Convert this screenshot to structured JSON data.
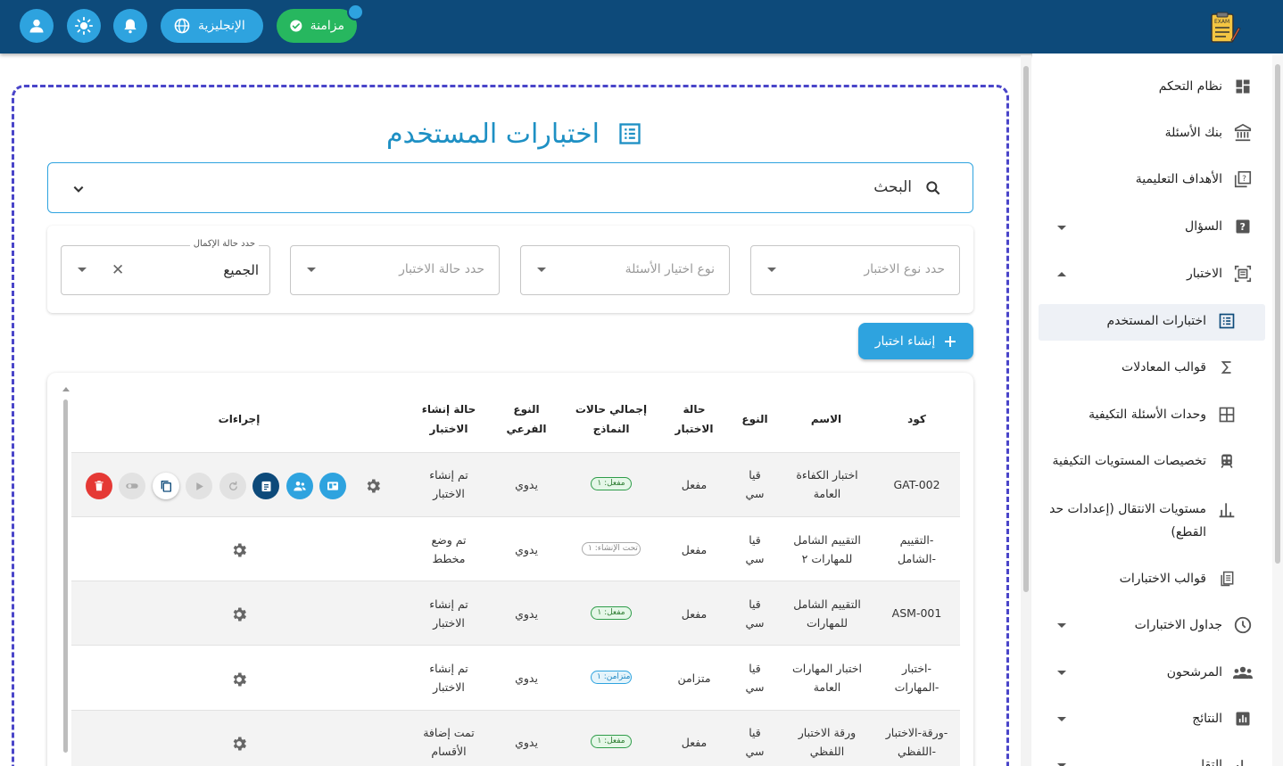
{
  "topbar": {
    "sync_label": "مزامنة",
    "language_label": "الإنجليزية",
    "logo_text": "EXAM"
  },
  "sidebar": {
    "items": [
      {
        "label": "نظام التحكم",
        "icon": "dashboard-icon"
      },
      {
        "label": "بنك الأسئلة",
        "icon": "bank-icon"
      },
      {
        "label": "الأهداف التعليمية",
        "icon": "objectives-icon"
      },
      {
        "label": "السؤال",
        "icon": "question-icon",
        "expandable": true
      },
      {
        "label": "الاختبار",
        "icon": "exam-icon",
        "expandable": true,
        "expanded": true
      },
      {
        "label": "اختبارات المستخدم",
        "icon": "list-icon",
        "active": true
      },
      {
        "label": "قوالب المعادلات",
        "icon": "sigma-icon"
      },
      {
        "label": "وحدات الأسئلة التكيفية",
        "icon": "grid-icon"
      },
      {
        "label": "تخصيصات المستويات التكيفية",
        "icon": "train-icon"
      },
      {
        "label": "مستويات الانتقال (إعدادات حد القطع)",
        "icon": "bar-chart-icon"
      },
      {
        "label": "قوالب الاختبارات",
        "icon": "template-icon"
      },
      {
        "label": "جداول الاختبارات",
        "icon": "clock-icon",
        "expandable": true
      },
      {
        "label": "المرشحون",
        "icon": "people-icon",
        "expandable": true
      },
      {
        "label": "النتائج",
        "icon": "results-icon",
        "expandable": true
      },
      {
        "label": "التقا",
        "icon": "reports-icon",
        "expandable": true
      }
    ]
  },
  "main": {
    "title": "اختبارات المستخدم",
    "search_label": "البحث",
    "filters": {
      "exam_type_placeholder": "حدد نوع الاختبار",
      "question_type_placeholder": "نوع اختيار الأسئلة",
      "exam_status_placeholder": "حدد حالة الاختبار",
      "completion_label": "حدد حالة الإكمال",
      "completion_value": "الجميع"
    },
    "create_button": "إنشاء اختبار"
  },
  "table": {
    "headers": {
      "code": "كود",
      "name": "الاسم",
      "type": "النوع",
      "status_1": "حالة",
      "status_2": "الاختبار",
      "forms_1": "إجمالي حالات",
      "forms_2": "النماذج",
      "subtype_1": "النوع",
      "subtype_2": "الفرعي",
      "creation_1": "حالة إنشاء",
      "creation_2": "الاختبار",
      "actions": "إجراءات"
    },
    "rows": [
      {
        "code_1": "GAT-002",
        "code_2": "",
        "name_1": "اختبار الكفاءة",
        "name_2": "العامة",
        "type_1": "قيا",
        "type_2": "سي",
        "status": "مفعل",
        "forms": "مفعل: ١",
        "forms_style": "green",
        "subtype": "يدوي",
        "creation_1": "تم إنشاء",
        "creation_2": "الاختبار"
      },
      {
        "code_1": "التقييم-",
        "code_2": "الشامل-",
        "name_1": "التقييم الشامل",
        "name_2": "للمهارات ٢",
        "type_1": "قيا",
        "type_2": "سي",
        "status": "مفعل",
        "forms": "تحت الإنشاء: ١",
        "forms_style": "gray",
        "subtype": "يدوي",
        "creation_1": "تم وضع",
        "creation_2": "مخطط"
      },
      {
        "code_1": "ASM-001",
        "code_2": "",
        "name_1": "التقييم الشامل",
        "name_2": "للمهارات",
        "type_1": "قيا",
        "type_2": "سي",
        "status": "مفعل",
        "forms": "مفعل: ١",
        "forms_style": "green",
        "subtype": "يدوي",
        "creation_1": "تم إنشاء",
        "creation_2": "الاختبار"
      },
      {
        "code_1": "اختبار-",
        "code_2": "المهارات-",
        "name_1": "اختبار المهارات",
        "name_2": "العامة",
        "type_1": "قيا",
        "type_2": "سي",
        "status": "متزامن",
        "forms": "متزامن: ١",
        "forms_style": "blue",
        "subtype": "يدوي",
        "creation_1": "تم إنشاء",
        "creation_2": "الاختبار"
      },
      {
        "code_1": "ورقة-الاختبار-",
        "code_2": "اللفظي-",
        "name_1": "ورقة الاختبار",
        "name_2": "اللفظي",
        "type_1": "قيا",
        "type_2": "سي",
        "status": "مفعل",
        "forms": "مفعل: ١",
        "forms_style": "green",
        "subtype": "يدوي",
        "creation_1": "تمت إضافة",
        "creation_2": "الأقسام"
      }
    ]
  },
  "colors": {
    "topbar": "#0d4a7a",
    "accent": "#2ea3df",
    "sync_green": "#27b75f",
    "frame_dashed": "#4a45c9",
    "delete_red": "#e53935",
    "action_dark": "#0d4a7a"
  }
}
